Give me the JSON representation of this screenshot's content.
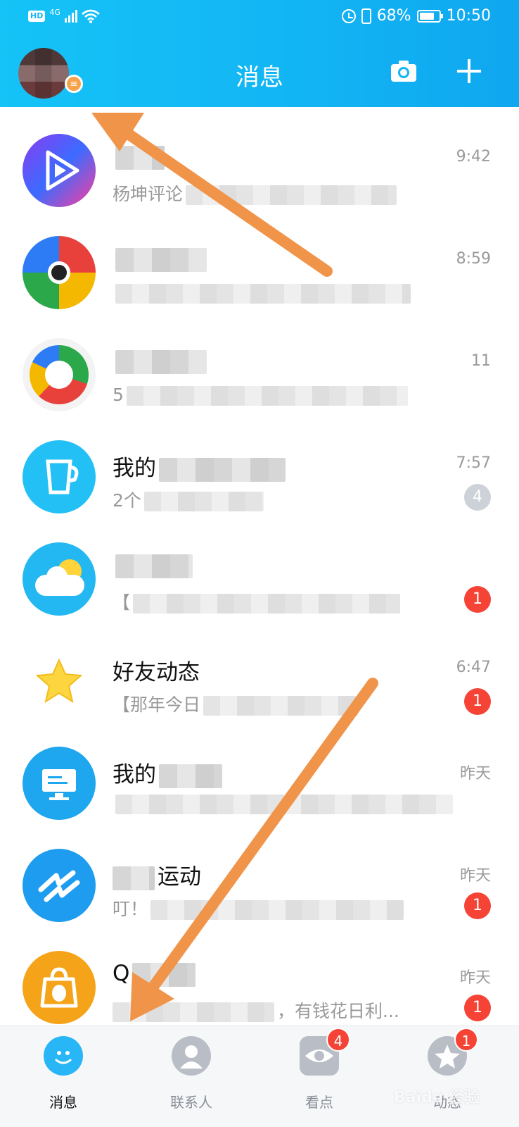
{
  "status_bar": {
    "hd_label": "HD",
    "network_label": "4G",
    "battery_percent": "68%",
    "time": "10:50",
    "icons": [
      "signal-icon",
      "wifi-icon",
      "alarm-icon",
      "vibrate-icon",
      "battery-icon"
    ]
  },
  "header": {
    "title": "消息",
    "avatar_badge": "≡",
    "icons": [
      "camera-icon",
      "plus-icon"
    ]
  },
  "chats": [
    {
      "name": "",
      "preview": "杨坤评论",
      "time": "9:42",
      "badge": "",
      "badge_color": "#f54336",
      "icon": "video-play-icon"
    },
    {
      "name": "",
      "preview": "",
      "time": "8:59",
      "badge": "",
      "badge_color": "#f54336",
      "icon": "app-icon"
    },
    {
      "name": "",
      "preview": "5",
      "time": "11",
      "badge": "",
      "badge_color": "#f54336",
      "icon": "browser-icon"
    },
    {
      "name": "我的",
      "preview": "2个",
      "time": "7:57",
      "badge": "4",
      "badge_color": "#cdd2d8",
      "icon": "cup-icon"
    },
    {
      "name": "",
      "preview": "【",
      "time": "",
      "badge": "1",
      "badge_color": "#f54336",
      "icon": "weather-icon"
    },
    {
      "name": "好友动态",
      "preview": "【那年今日",
      "time": "6:47",
      "badge": "1",
      "badge_color": "#f54336",
      "icon": "star-icon"
    },
    {
      "name": "我的",
      "preview": "",
      "time": "昨天",
      "badge": "",
      "badge_color": "#f54336",
      "icon": "computer-icon"
    },
    {
      "name": "运动",
      "preview": "叮！",
      "time": "昨天",
      "badge": "1",
      "badge_color": "#f54336",
      "icon": "sport-icon"
    },
    {
      "name": "Q",
      "preview": "，有钱花日利...",
      "time": "昨天",
      "badge": "1",
      "badge_color": "#f54336",
      "icon": "penguin-icon"
    }
  ],
  "tabs": [
    {
      "label": "消息",
      "badge": "",
      "icon": "message-icon",
      "active": true
    },
    {
      "label": "联系人",
      "badge": "",
      "icon": "contacts-icon",
      "active": false
    },
    {
      "label": "看点",
      "badge": "4",
      "icon": "eye-icon",
      "active": false
    },
    {
      "label": "动态",
      "badge": "1",
      "icon": "star-icon",
      "active": false
    }
  ],
  "colors": {
    "header_start": "#15c3f7",
    "header_end": "#0fa7f0",
    "badge_red": "#f54336",
    "arrow": "#f0944a"
  },
  "watermark": "Baidu 经验"
}
